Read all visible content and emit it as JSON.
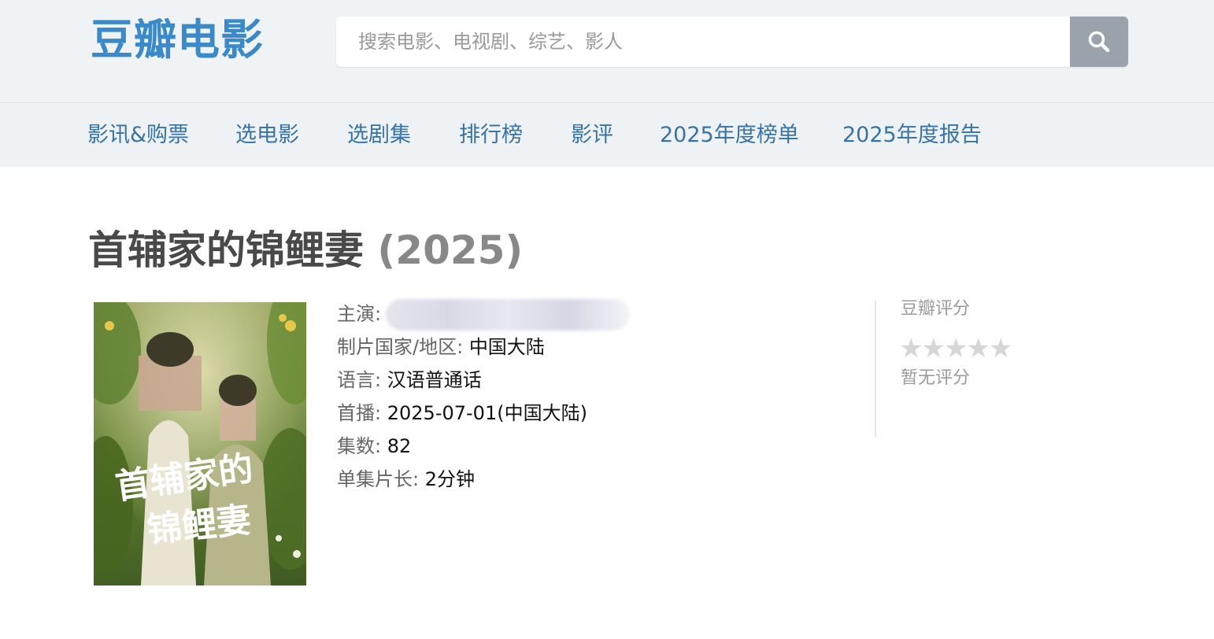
{
  "header": {
    "logo_text": "豆瓣电影",
    "search_placeholder": "搜索电影、电视剧、综艺、影人",
    "search_icon": "search-icon"
  },
  "nav": {
    "items": [
      {
        "label": "影讯&购票"
      },
      {
        "label": "选电影"
      },
      {
        "label": "选剧集"
      },
      {
        "label": "排行榜"
      },
      {
        "label": "影评"
      },
      {
        "label": "2025年度榜单"
      },
      {
        "label": "2025年度报告"
      }
    ]
  },
  "subject": {
    "title": "首辅家的锦鲤妻",
    "year": "(2025)",
    "poster_title_line1": "首辅家的",
    "poster_title_line2": "锦鲤妻",
    "info": {
      "cast_label": "主演:",
      "country_label": "制片国家/地区:",
      "country_value": "中国大陆",
      "language_label": "语言:",
      "language_value": "汉语普通话",
      "premiere_label": "首播:",
      "premiere_value": "2025-07-01(中国大陆)",
      "episodes_label": "集数:",
      "episodes_value": "82",
      "runtime_label": "单集片长:",
      "runtime_value": "2分钟"
    }
  },
  "rating": {
    "label": "豆瓣评分",
    "stars": "★★★★★",
    "empty_text": "暂无评分",
    "star_color": "#d6d6d6"
  },
  "colors": {
    "logo": "#3a89c9",
    "nav_link": "#3773a5",
    "header_bg": "#f0f3f5",
    "title": "#494949",
    "year": "#888888"
  }
}
